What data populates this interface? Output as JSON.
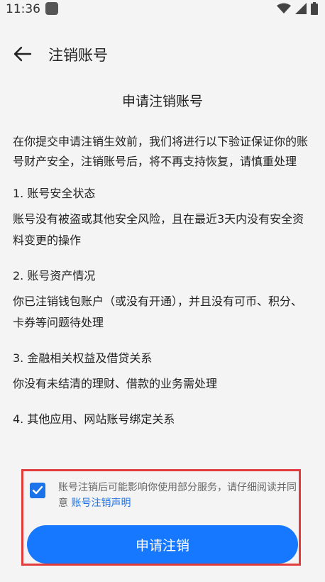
{
  "status_bar": {
    "time": "11:36"
  },
  "header": {
    "title": "注销账号"
  },
  "document": {
    "title": "申请注销账号",
    "intro": "在你提交申请注销生效前，我们将进行以下验证保证你的账号财产安全，注销账号后，将不再支持恢复，请慎重处理",
    "sections": [
      {
        "title": "1. 账号安全状态",
        "body": "账号没有被盗或其他安全风险，且在最近3天内没有安全资料变更的操作"
      },
      {
        "title": "2. 账号资产情况",
        "body": "你已注销钱包账户（或没有开通），并且没有可币、积分、卡券等问题待处理"
      },
      {
        "title": "3. 金融相关权益及借贷关系",
        "body": "你没有未结清的理财、借款的业务需处理"
      },
      {
        "title": "4. 其他应用、网站账号绑定关系",
        "body": ""
      }
    ]
  },
  "agreement": {
    "checked": true,
    "text": "账号注销后可能影响你使用部分服务，请仔细阅读并同意 ",
    "link_text": "账号注销声明"
  },
  "actions": {
    "submit_label": "申请注销"
  },
  "colors": {
    "accent": "#1677ff",
    "link": "#1a73e8",
    "highlight": "#e23b3b"
  },
  "icons": {
    "back": "arrow-left-icon",
    "wifi": "wifi-icon",
    "signal": "signal-icon",
    "battery": "battery-icon",
    "check": "check-icon"
  }
}
